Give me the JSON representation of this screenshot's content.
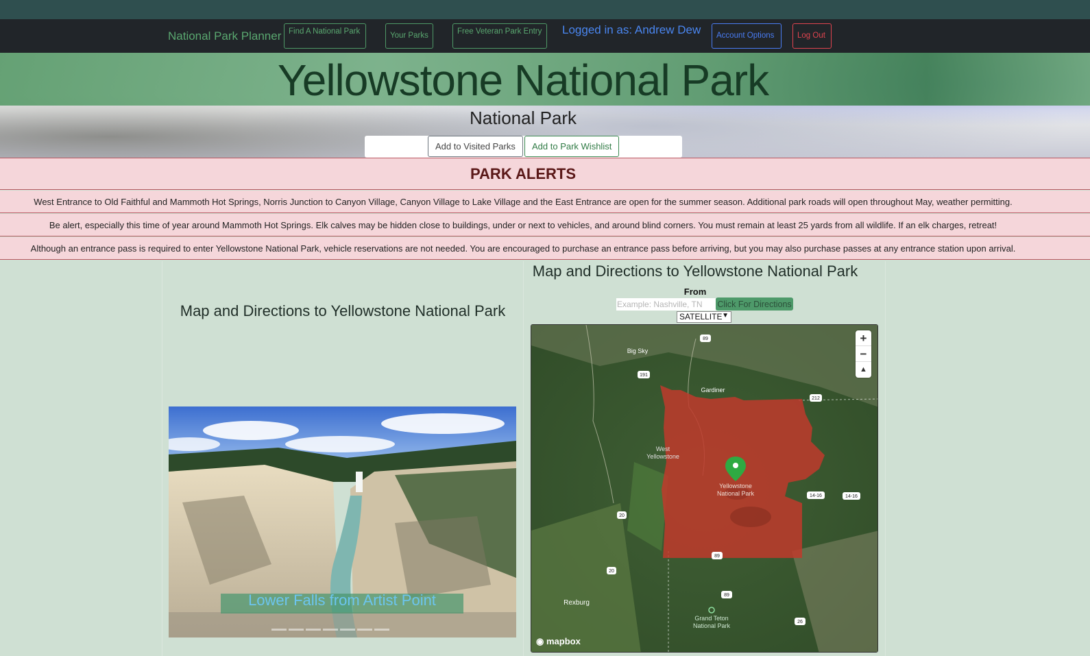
{
  "nav": {
    "brand": "National Park Planner",
    "find_park": "Find A National Park",
    "your_parks": "Your Parks",
    "veteran_entry": "Free Veteran Park Entry",
    "logged_in": "Logged in as: Andrew Dew",
    "account_options": "Account Options",
    "log_out": "Log Out"
  },
  "park": {
    "name": "Yellowstone National Park",
    "designation": "National Park",
    "add_visited": "Add to Visited Parks",
    "add_wishlist": "Add to Park Wishlist"
  },
  "alerts": {
    "title": "PARK ALERTS",
    "items": [
      "West Entrance to Old Faithful and Mammoth Hot Springs, Norris Junction to Canyon Village, Canyon Village to Lake Village and the East Entrance are open for the summer season. Additional park roads will open throughout May, weather permitting.",
      "Be alert, especially this time of year around Mammoth Hot Springs. Elk calves may be hidden close to buildings, under or next to vehicles, and around blind corners. You must remain at least 25 yards from all wildlife. If an elk charges, retreat!",
      "Although an entrance pass is required to enter Yellowstone National Park, vehicle reservations are not needed. You are encouraged to purchase an entrance pass before arriving, but you may also purchase passes at any entrance station upon arrival."
    ]
  },
  "left_panel": {
    "heading": "Map and Directions to Yellowstone National Park",
    "carousel_caption": "Lower Falls from Artist Point"
  },
  "right_panel": {
    "heading": "Map and Directions to Yellowstone National Park",
    "from_label": "From",
    "from_placeholder": "Example: Nashville, TN",
    "directions_button": "Click For Directions",
    "map_type": "SATELLITE"
  },
  "map": {
    "labels": {
      "big_sky": "Big Sky",
      "gardiner": "Gardiner",
      "west_yellowstone": "West Yellowstone",
      "park_label": "Yellowstone National Park",
      "rexburg": "Rexburg",
      "grand_teton": "Grand Teton National Park"
    },
    "shields": [
      "89",
      "191",
      "212",
      "14-16",
      "14-16",
      "20",
      "20",
      "89",
      "89",
      "26"
    ],
    "zoom_in": "+",
    "zoom_out": "−",
    "compass": "▲",
    "attribution": "mapbox",
    "park_fill_color": "#c0392b"
  },
  "colors": {
    "nav_bg": "#212529",
    "page_bg": "#cfe0d3",
    "alert_bg": "#f5d6da",
    "accent_green": "#5aa870"
  }
}
